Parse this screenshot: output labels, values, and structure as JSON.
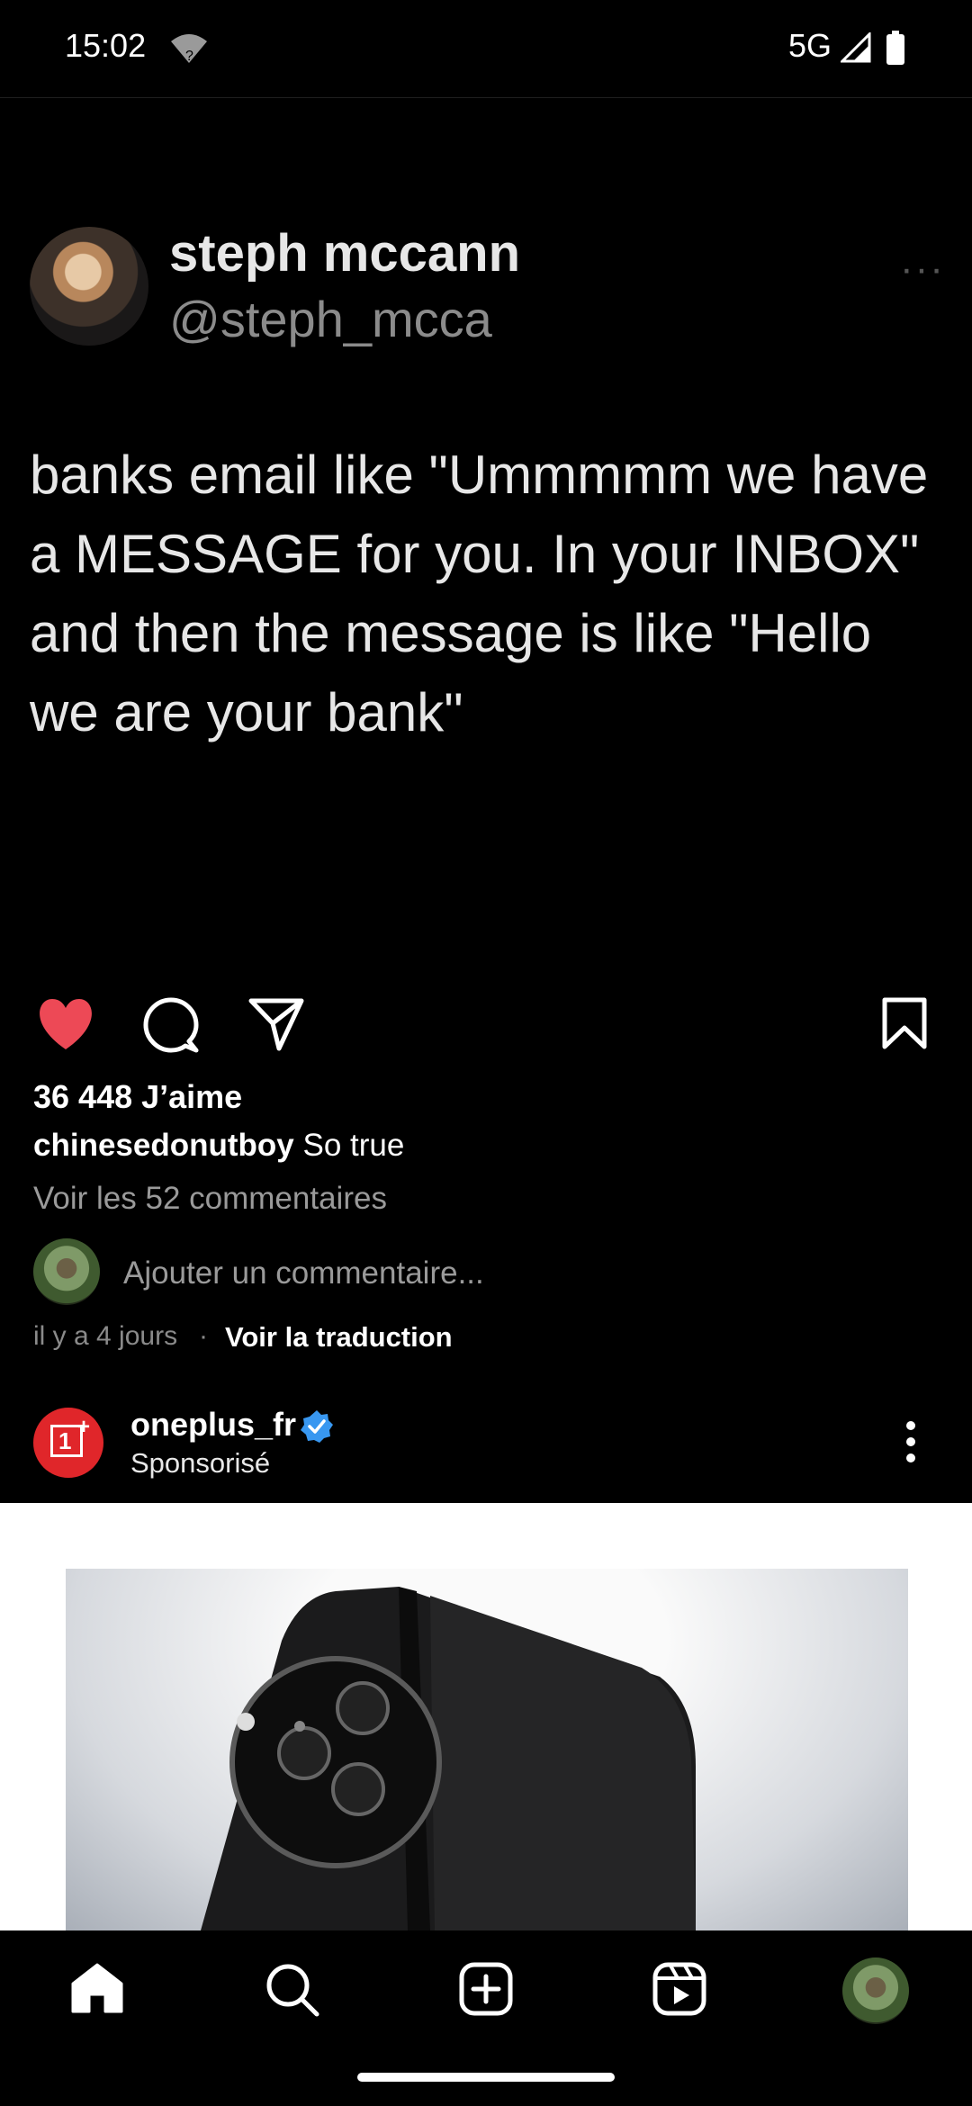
{
  "status_bar": {
    "time": "15:02",
    "network": "5G"
  },
  "tweet": {
    "name": "steph mccann",
    "handle": "@steph_mcca",
    "more": "···",
    "text": "banks email like \"Ummmmm we have a MESSAGE for you. In your INBOX\" and then the message is like \"Hello we are your bank\""
  },
  "post": {
    "likes": "36 448 J’aime",
    "caption_user": "chinesedonutboy",
    "caption_text": " So true",
    "view_comments": "Voir les 52 commentaires",
    "add_comment_placeholder": "Ajouter un commentaire...",
    "time_ago": "il y a 4 jours",
    "separator": "·",
    "translate": "Voir la traduction",
    "liked": true,
    "like_color": "#ed4956"
  },
  "ad": {
    "account": "oneplus_fr",
    "sponsored": "Sponsorisé",
    "verified_color": "#3897f0",
    "logo_color": "#e0262a"
  },
  "nav": {
    "items": [
      "home-icon",
      "search-icon",
      "create-icon",
      "reels-icon",
      "profile-avatar"
    ]
  }
}
